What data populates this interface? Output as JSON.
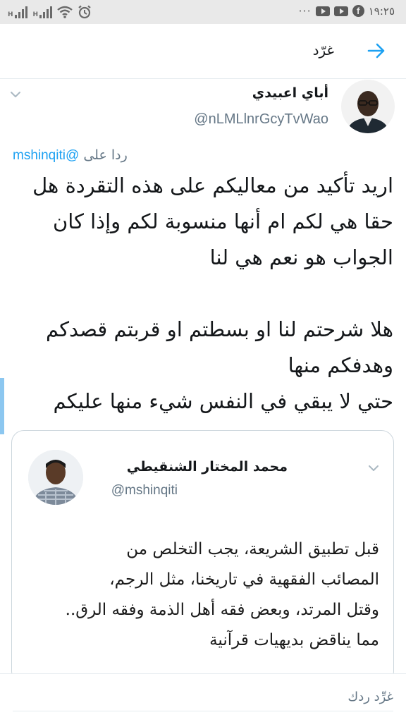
{
  "status_bar": {
    "time": "١٩:٢٥",
    "overflow": "···",
    "signal_1_label": "H",
    "signal_2_label": "H",
    "icons": [
      "signal-icon",
      "signal-icon",
      "wifi-icon",
      "alarm-icon",
      "youtube-icon",
      "youtube-icon",
      "facebook-icon"
    ]
  },
  "header": {
    "title": "غرّد",
    "back_icon": "arrow-right-icon"
  },
  "tweet": {
    "author_name": "أباي اعبيدي",
    "author_handle": "@nLMLlnrGcyTvWao",
    "reply_prefix": "ردا على",
    "reply_to": "@mshinqiti",
    "text": "اريد تأكيد من معاليكم على هذه التقردة هل حقا هي لكم ام أنها منسوبة لكم وإذا كان الجواب هو نعم هي لنا\n\nهلا شرحتم لنا او بسطتم او قربتم قصدكم وهدفكم منها\nحتي لا يبقي في النفس شيء منها عليكم"
  },
  "quoted_tweet": {
    "author_name": "محمد المختار الشنقيطي",
    "author_handle": "@mshinqiti",
    "image_text": "قبل تطبيق الشريعة، يجب التخلص من\nالمصائب الفقهية في تاريخنا، مثل الرجم،\nوقتل المرتد، وبعض فقه أهل الذمة وفقه الرق..\nمما يناقض بديهيات قرآنية"
  },
  "reply": {
    "placeholder": "غرِّد ردك"
  },
  "colors": {
    "accent": "#1da1f2",
    "secondary_text": "#657786",
    "border": "#ccd6dd",
    "status_bar_bg": "#e9e9e9"
  }
}
